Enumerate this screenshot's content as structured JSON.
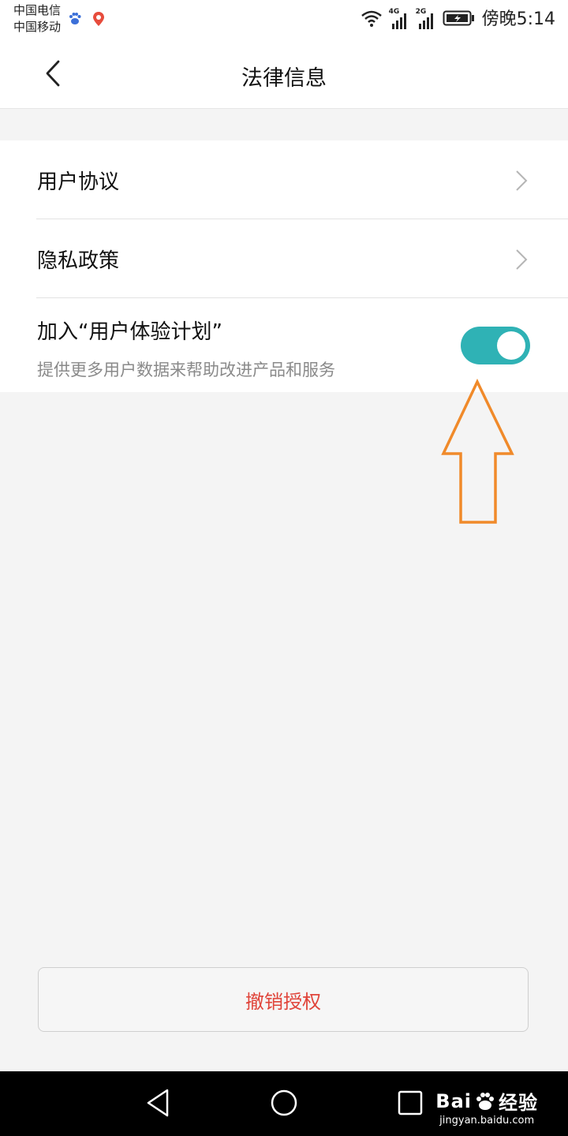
{
  "status_bar": {
    "carrier_1": "中国电信",
    "carrier_2": "中国移动",
    "network_1": "4G",
    "network_2": "2G",
    "time": "傍晚5:14",
    "icons": [
      "baidu-paw-icon",
      "map-pin-icon",
      "wifi-icon",
      "signal-icon",
      "signal-icon",
      "battery-charging-icon"
    ]
  },
  "header": {
    "title": "法律信息",
    "back_icon": "chevron-left-icon"
  },
  "settings": {
    "items": [
      {
        "label": "用户协议",
        "icon": "chevron-right-icon"
      },
      {
        "label": "隐私政策",
        "icon": "chevron-right-icon"
      },
      {
        "label": "加入“用户体验计划”",
        "description": "提供更多用户数据来帮助改进产品和服务",
        "toggle_on": true
      }
    ]
  },
  "annotation": {
    "icon": "up-arrow-icon",
    "color": "#f08a2a"
  },
  "actions": {
    "revoke_label": "撤销授权"
  },
  "colors": {
    "accent": "#2fb2b5",
    "danger_text": "#e0443a",
    "background": "#f4f4f4"
  },
  "watermark": {
    "brand_left": "Bai",
    "brand_right": "经验",
    "url": "jingyan.baidu.com"
  }
}
